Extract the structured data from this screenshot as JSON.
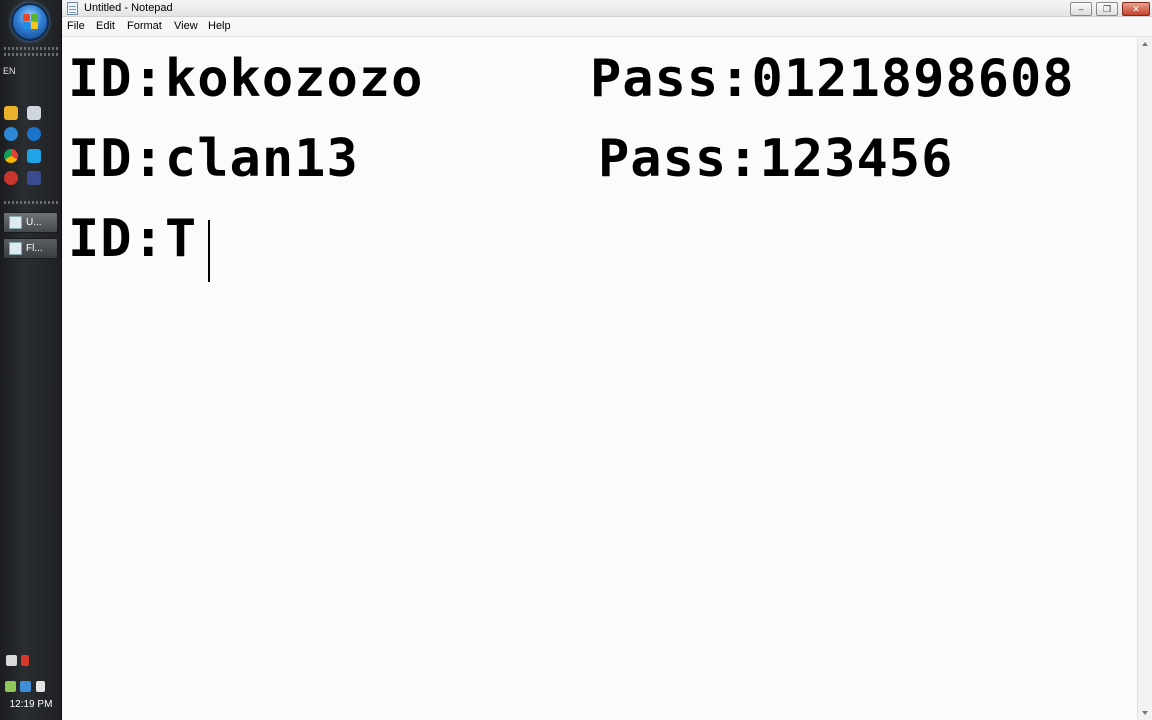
{
  "taskbar": {
    "language": "EN",
    "tasks": [
      {
        "label": "U...",
        "icon": "notepad-icon"
      },
      {
        "label": "Fl...",
        "icon": "flash-icon"
      }
    ],
    "clock": "12:19 PM"
  },
  "window": {
    "title": "Untitled - Notepad",
    "menu": [
      "File",
      "Edit",
      "Format",
      "View",
      "Help"
    ],
    "controls": [
      "minimize",
      "maximize",
      "close"
    ]
  },
  "editor": {
    "lines": [
      {
        "id": "ID:kokozozo",
        "pass": "Pass:0121898608"
      },
      {
        "id": "ID:clan13",
        "pass": "Pass:123456"
      },
      {
        "id": "ID:T",
        "pass": ""
      }
    ]
  },
  "colors": {
    "taskbar": "#24272a",
    "editor_bg": "#fbfbfb",
    "text": "#000000"
  }
}
